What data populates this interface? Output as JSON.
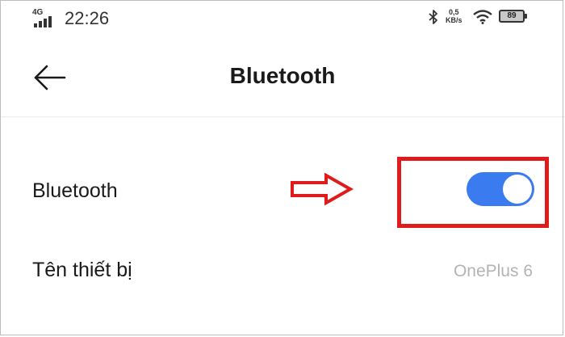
{
  "status_bar": {
    "network_type": "4G",
    "time": "22:26",
    "speed_value": "0,5",
    "speed_unit": "KB/s",
    "battery_level": "89"
  },
  "header": {
    "title": "Bluetooth"
  },
  "settings": {
    "bluetooth_label": "Bluetooth",
    "bluetooth_enabled": true,
    "device_name_label": "Tên thiết bị",
    "device_name_value": "OnePlus 6"
  },
  "colors": {
    "toggle_on": "#3a7bef",
    "annotation_red": "#e01b1b",
    "secondary_text": "#b4b4b4"
  },
  "icons": {
    "back": "arrow-left-icon",
    "bluetooth": "bluetooth-icon",
    "wifi": "wifi-icon",
    "signal": "signal-icon",
    "battery": "battery-icon"
  }
}
